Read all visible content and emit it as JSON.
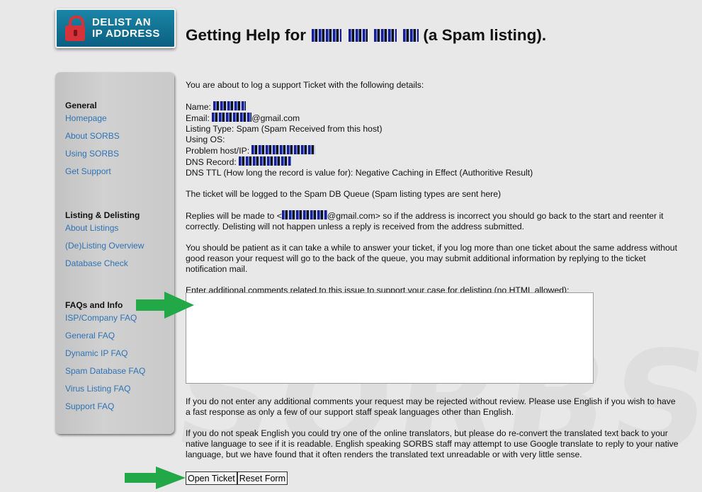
{
  "logo": {
    "line1": "DELIST AN",
    "line2": "IP ADDRESS",
    "icon": "lock-icon",
    "color": "#0f6e92"
  },
  "header": {
    "title_prefix": "Getting Help for",
    "title_suffix": "(a Spam listing)."
  },
  "watermark": "SORBS",
  "sidebar": {
    "sections": [
      {
        "heading": "General",
        "links": [
          "Homepage",
          "About SORBS",
          "Using SORBS",
          "Get Support"
        ]
      },
      {
        "heading": "Listing & Delisting",
        "links": [
          "About Listings",
          "(De)Listing Overview",
          "Database Check"
        ]
      },
      {
        "heading": "FAQs and Info",
        "links": [
          "ISP/Company FAQ",
          "General FAQ",
          "Dynamic IP FAQ",
          "Spam Database FAQ",
          "Virus Listing FAQ",
          "Support FAQ"
        ]
      }
    ],
    "link_color": "#2f73b4"
  },
  "ticket": {
    "intro": "You are about to log a support Ticket with the following details:",
    "name_label": "Name:",
    "email_label": "Email:",
    "email_suffix": "@gmail.com",
    "listing_type": "Listing Type: Spam (Spam Received from this host)",
    "using_os": "Using OS:",
    "host_label": "Problem host/IP:",
    "dns_label": "DNS Record:",
    "dns_ttl": "DNS TTL (How long the record is value for): Negative Caching in Effect (Authoritive Result)",
    "queue": "The ticket will be logged to the Spam DB Queue (Spam listing types are sent here)",
    "replies_prefix": "Replies will be made to <",
    "replies_suffix": "@gmail.com> so if the address is incorrect you should go back to the start and reenter it correctly. Delisting will not happen unless a reply is received from the address submitted.",
    "patience": "You should be patient as it can take a while to answer your ticket, if you log more than one ticket about the same address without good reason your request will go to the back of the queue, you may submit additional information by replying to the ticket notification mail.",
    "comments_label": "Enter additional comments related to this issue to support your case for delisting (no HTML allowed):",
    "comments_value": "",
    "warning": "If you do not enter any additional comments your request may be rejected without review. Please use English if you wish to have a fast response as only a few of our support staff speak languages other than English.",
    "translate": "If you do not speak English you could try one of the online translators, but please do re-convert the translated text back to your native language to see if it is readable. English speaking SORBS staff may attempt to use Google translate to reply to your native language, but we have found that it often renders the translated text unreadable or with very little sense."
  },
  "buttons": {
    "open": "Open Ticket",
    "reset": "Reset Form"
  },
  "annotations": {
    "arrow_color": "#22a846"
  }
}
